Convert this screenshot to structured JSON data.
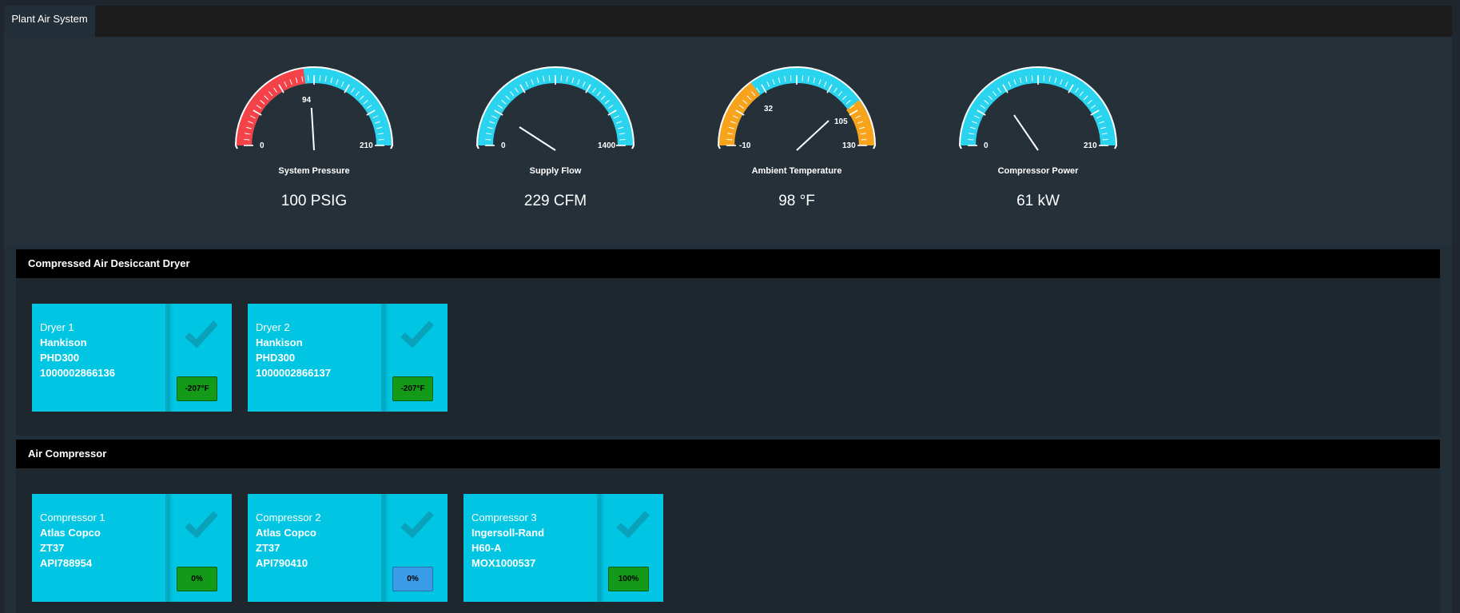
{
  "tabs": [
    {
      "label": "Plant Air System"
    }
  ],
  "gauges": [
    {
      "title": "System Pressure",
      "value_text": "100 PSIG",
      "min_label": "0",
      "max_label": "210",
      "marks": [
        "94"
      ],
      "min": 0,
      "max": 210,
      "value": 100
    },
    {
      "title": "Supply Flow",
      "value_text": "229 CFM",
      "min_label": "0",
      "max_label": "1400",
      "marks": [],
      "min": 0,
      "max": 1400,
      "value": 229
    },
    {
      "title": "Ambient Temperature",
      "value_text": "98 °F",
      "min_label": "-10",
      "max_label": "130",
      "marks": [
        "32",
        "105"
      ],
      "min": -10,
      "max": 130,
      "value": 98
    },
    {
      "title": "Compressor Power",
      "value_text": "61 kW",
      "min_label": "0",
      "max_label": "210",
      "marks": [],
      "min": 0,
      "max": 210,
      "value": 61
    }
  ],
  "sections": [
    {
      "title": "Compressed Air Desiccant Dryer",
      "cards": [
        {
          "name": "Dryer 1",
          "make": "Hankison",
          "model": "PHD300",
          "serial": "1000002866136",
          "badge": "-207°F",
          "badge_color": "green"
        },
        {
          "name": "Dryer 2",
          "make": "Hankison",
          "model": "PHD300",
          "serial": "1000002866137",
          "badge": "-207°F",
          "badge_color": "green"
        }
      ]
    },
    {
      "title": "Air Compressor",
      "cards": [
        {
          "name": "Compressor 1",
          "make": "Atlas Copco",
          "model": "ZT37",
          "serial": "API788954",
          "badge": "0%",
          "badge_color": "green"
        },
        {
          "name": "Compressor 2",
          "make": "Atlas Copco",
          "model": "ZT37",
          "serial": "API790410",
          "badge": "0%",
          "badge_color": "blue"
        },
        {
          "name": "Compressor 3",
          "make": "Ingersoll-Rand",
          "model": "H60-A",
          "serial": "MOX1000537",
          "badge": "100%",
          "badge_color": "green"
        }
      ]
    }
  ],
  "colors": {
    "cyan": "#2ad4ee",
    "red": "#f44248",
    "orange": "#f7a31b",
    "card": "#00c6e4",
    "badge_green": "#139a18",
    "badge_blue": "#3a9be6"
  },
  "icons": {
    "card_status": "check-icon"
  }
}
